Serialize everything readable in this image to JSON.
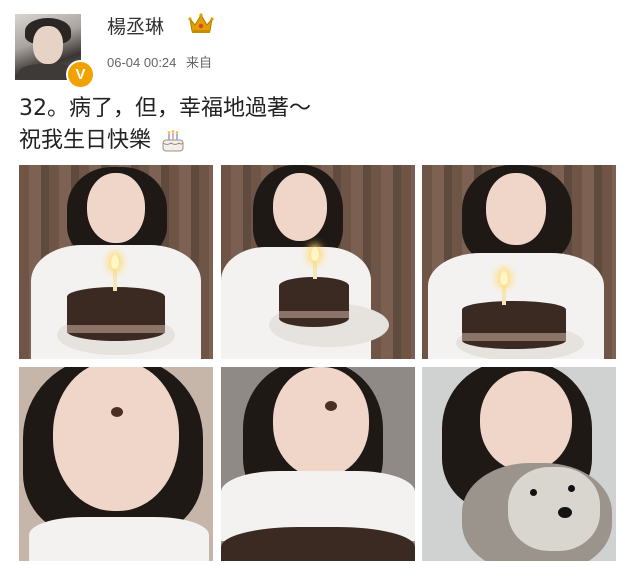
{
  "post": {
    "username": "楊丞琳",
    "timestamp": "06-04 00:24",
    "source": "来自",
    "text_line1": "32。病了，但，幸福地過著～",
    "text_line2": "祝我生日快樂",
    "badge_letter": "V"
  },
  "icons": {
    "crown": "crown-icon",
    "verified": "verified-badge-icon",
    "cake_emoji": "birthday-cake-emoji"
  },
  "colors": {
    "badge": "#f1a100",
    "crown": "#e0a000",
    "crown_gem": "#e23b3b"
  },
  "photos": [
    {
      "id": 1,
      "subject": "woman holding birthday cake with lit candle"
    },
    {
      "id": 2,
      "subject": "woman blowing kiss holding cake"
    },
    {
      "id": 3,
      "subject": "woman smiling over cake with candle"
    },
    {
      "id": 4,
      "subject": "close-up selfie with chocolate on nose"
    },
    {
      "id": 5,
      "subject": "selfie with chocolate on nose, cake in front"
    },
    {
      "id": 6,
      "subject": "selfie with schnauzer dog"
    }
  ]
}
